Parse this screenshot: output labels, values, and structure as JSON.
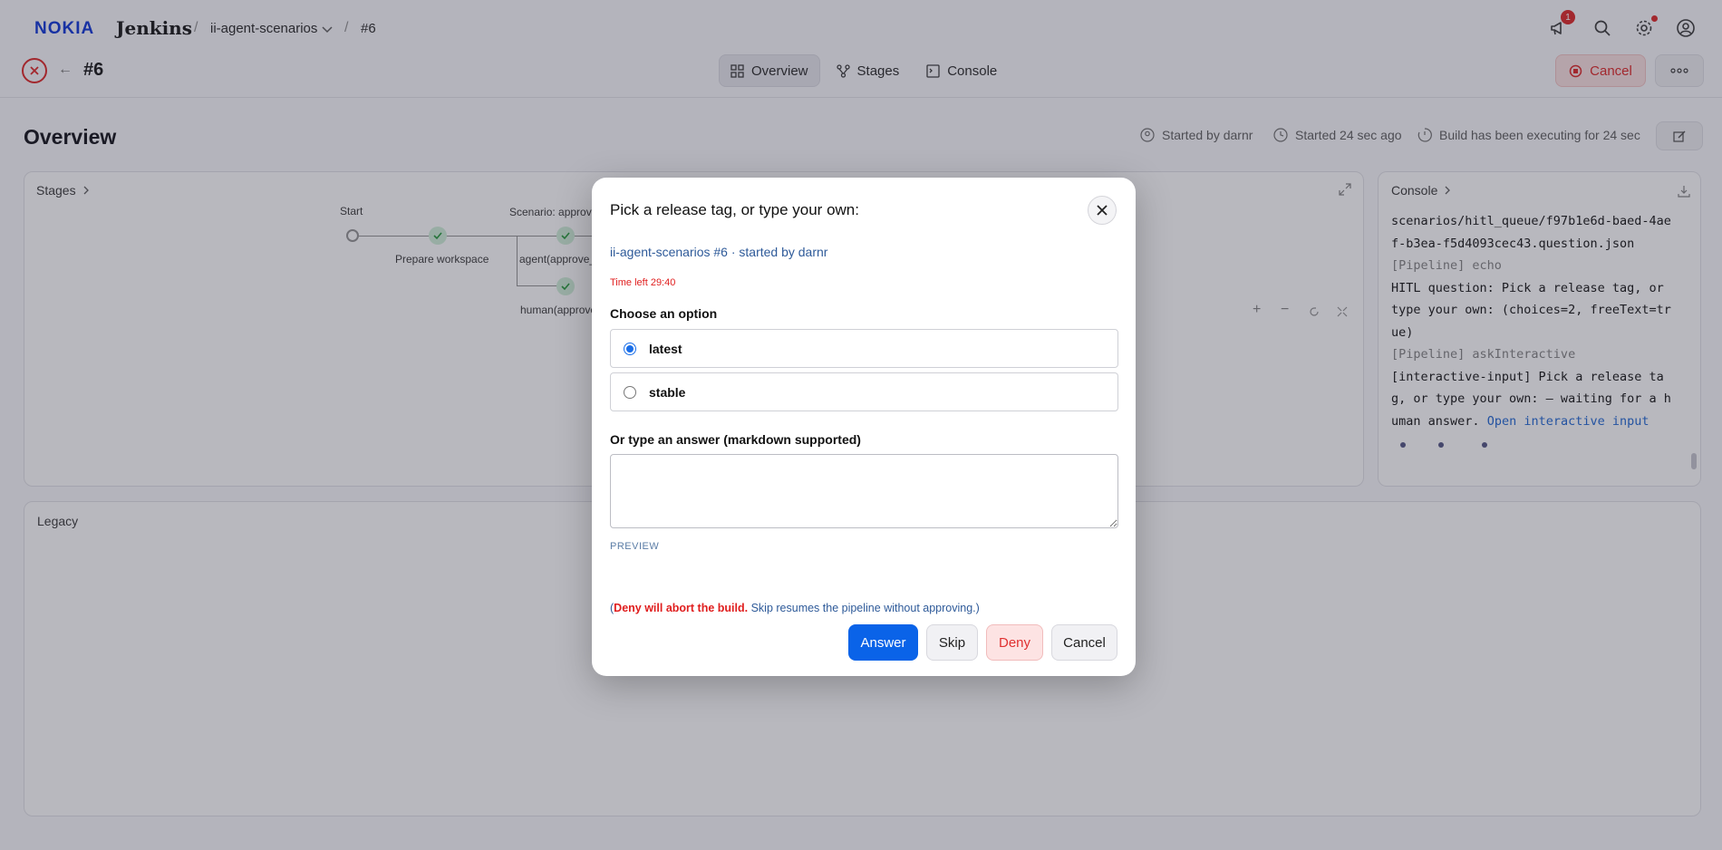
{
  "header": {
    "logo": "NOKIA",
    "brand": "Jenkins",
    "breadcrumb": [
      "ii-agent-scenarios",
      "#6"
    ],
    "notification_count": "1",
    "icons": [
      "megaphone-icon",
      "search-icon",
      "gear-icon",
      "user-icon"
    ]
  },
  "build": {
    "number": "#6",
    "status_icon": "failed-x-icon",
    "tabs": [
      "Overview",
      "Stages",
      "Console"
    ],
    "active_tab": "Overview",
    "cancel_label": "Cancel"
  },
  "overview": {
    "title": "Overview",
    "started_by": "Started by darnr",
    "started_ago": "Started 24 sec ago",
    "executing": "Build has been executing for 24 sec"
  },
  "stages_panel": {
    "title": "Stages",
    "nodes": [
      "Start",
      "Prepare workspace",
      "Scenario: approv",
      "agent(approve_",
      "human(approve"
    ]
  },
  "console_panel": {
    "title": "Console",
    "lines": [
      {
        "text": "scenarios/hitl_queue/f97b1e6d-baed-4aef-b3ea-f5d4093cec43.question.json",
        "style": "normal"
      },
      {
        "text": "[Pipeline] echo",
        "style": "dim"
      },
      {
        "text": "HITL question: Pick a release tag, or type your own: (choices=2, freeText=true)",
        "style": "normal"
      },
      {
        "text": "[Pipeline] askInteractive",
        "style": "dim"
      },
      {
        "text": "[interactive-input] Pick a release tag, or type your own: — waiting for a human answer.",
        "style": "normal"
      }
    ],
    "link": "Open interactive input"
  },
  "legacy_panel": {
    "title": "Legacy"
  },
  "modal": {
    "title": "Pick a release tag, or type your own:",
    "subtitle": "ii-agent-scenarios #6 · started by darnr",
    "time_left": "Time left 29:40",
    "choose_label": "Choose an option",
    "options": [
      {
        "label": "latest",
        "selected": true
      },
      {
        "label": "stable",
        "selected": false
      }
    ],
    "freetext_label": "Or type an answer (markdown supported)",
    "freetext_value": "",
    "preview_label": "PREVIEW",
    "note_open": "(",
    "note_deny": "Deny will abort the build.",
    "note_rest": " Skip resumes the pipeline without approving.)",
    "buttons": {
      "answer": "Answer",
      "skip": "Skip",
      "deny": "Deny",
      "cancel": "Cancel"
    }
  },
  "colors": {
    "primary": "#0a63e8",
    "danger": "#e03131",
    "success_node": "#d2f0da"
  }
}
